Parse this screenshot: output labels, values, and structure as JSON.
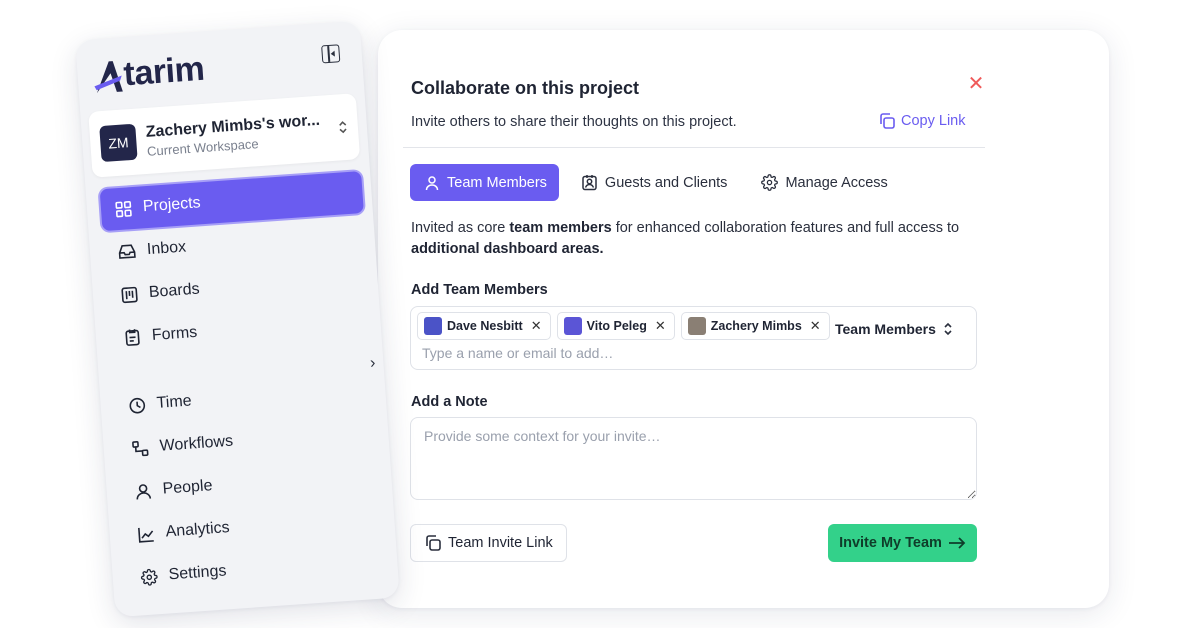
{
  "sidebar": {
    "logo": "tarim",
    "workspace": {
      "initials": "ZM",
      "name": "Zachery Mimbs's wor...",
      "subtitle": "Current Workspace"
    },
    "items": [
      {
        "label": "Projects",
        "icon": "grid-icon",
        "active": true
      },
      {
        "label": "Inbox",
        "icon": "inbox-icon"
      },
      {
        "label": "Boards",
        "icon": "board-icon"
      },
      {
        "label": "Forms",
        "icon": "form-icon"
      },
      {
        "label": "Time",
        "icon": "clock-icon"
      },
      {
        "label": "Workflows",
        "icon": "workflow-icon"
      },
      {
        "label": "People",
        "icon": "person-icon"
      },
      {
        "label": "Analytics",
        "icon": "chart-icon"
      },
      {
        "label": "Settings",
        "icon": "gear-icon"
      }
    ]
  },
  "dialog": {
    "title": "Collaborate on this project",
    "subtitle": "Invite others to share their thoughts on this project.",
    "copy_link": "Copy Link",
    "tabs": [
      {
        "label": "Team Members",
        "active": true
      },
      {
        "label": "Guests and Clients"
      },
      {
        "label": "Manage Access"
      }
    ],
    "description": {
      "prefix": "Invited as core ",
      "bold1": "team members",
      "middle": " for enhanced collaboration features and full access to ",
      "bold2": "additional dashboard areas."
    },
    "add_members_label": "Add Team Members",
    "members": [
      {
        "name": "Dave Nesbitt",
        "avatar_color": "#4b53c7"
      },
      {
        "name": "Vito Peleg",
        "avatar_color": "#5b55d6"
      },
      {
        "name": "Zachery Mimbs",
        "avatar_color": "#8a7f74"
      }
    ],
    "members_placeholder": "Type a name or email to add…",
    "role_select": "Team Members",
    "note_label": "Add a Note",
    "note_placeholder": "Provide some context for your invite…",
    "team_invite_link": "Team Invite Link",
    "invite_button": "Invite My Team"
  },
  "colors": {
    "accent": "#6a5cf0",
    "success": "#33d18a",
    "close": "#ef5a5a",
    "brand_dark": "#23264a"
  }
}
